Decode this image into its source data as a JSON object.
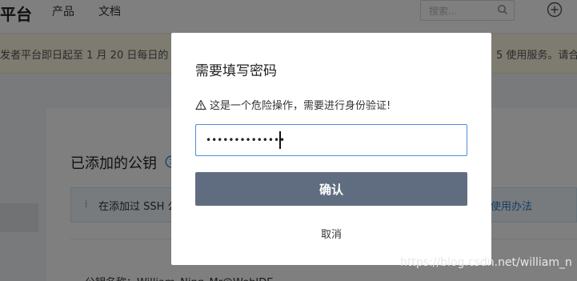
{
  "topbar": {
    "brand": "平台",
    "nav": [
      "产品",
      "文档"
    ],
    "search_placeholder": "搜索...",
    "icons": {
      "search": "search-icon",
      "add": "plus-circle-icon"
    }
  },
  "notice": {
    "left_text": "发者平台即日起至 1 月 20 日每日的",
    "right_text": "5 使用服务。请合"
  },
  "main": {
    "section_title": "已添加的公钥",
    "info_text": "在添加过 SSH 公",
    "info_link": "钥使用办法",
    "key_name_partial": "公钥名称：William_Ning_Mr@WebIDE"
  },
  "modal": {
    "title": "需要填写密码",
    "warning": "这是一个危险操作，需要进行身份验证!",
    "password_value": "••••••••••••••",
    "confirm_label": "确认",
    "cancel_label": "取消"
  },
  "watermark": "https://blog.csdn.net/william_n",
  "colors": {
    "overlay": "#00000080",
    "confirm_button": "#606d80",
    "input_focus_border": "#4a90d9",
    "notice_bg": "#fdf7e3"
  }
}
